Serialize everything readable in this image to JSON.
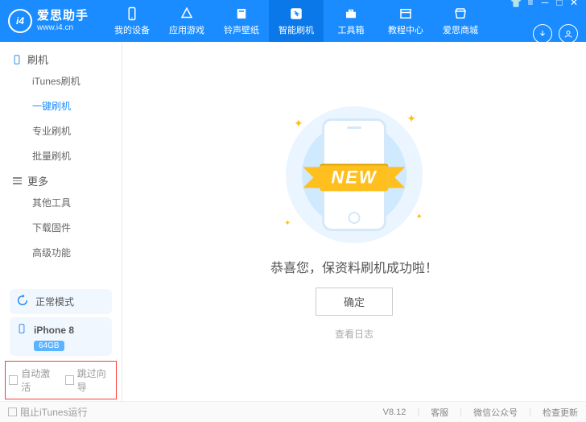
{
  "brand": {
    "name": "爱思助手",
    "url": "www.i4.cn"
  },
  "tabs": {
    "items": [
      {
        "label": "我的设备"
      },
      {
        "label": "应用游戏"
      },
      {
        "label": "铃声壁纸"
      },
      {
        "label": "智能刷机"
      },
      {
        "label": "工具箱"
      },
      {
        "label": "教程中心"
      },
      {
        "label": "爱思商城"
      }
    ],
    "active_index": 3
  },
  "sidebar": {
    "section1": {
      "label": "刷机"
    },
    "items1": [
      {
        "label": "iTunes刷机"
      },
      {
        "label": "一键刷机"
      },
      {
        "label": "专业刷机"
      },
      {
        "label": "批量刷机"
      }
    ],
    "active1": 1,
    "section2": {
      "label": "更多"
    },
    "items2": [
      {
        "label": "其他工具"
      },
      {
        "label": "下载固件"
      },
      {
        "label": "高级功能"
      }
    ],
    "mode": {
      "label": "正常模式"
    },
    "device": {
      "name": "iPhone 8",
      "storage": "64GB"
    },
    "opts": {
      "auto_activate": "自动激活",
      "skip_guide": "跳过向导"
    }
  },
  "main": {
    "ribbon": "NEW",
    "result": "恭喜您，保资料刷机成功啦！",
    "ok_btn": "确定",
    "log_link": "查看日志"
  },
  "footer": {
    "block_itunes": "阻止iTunes运行",
    "version": "V8.12",
    "support": "客服",
    "wechat": "微信公众号",
    "update": "检查更新"
  }
}
